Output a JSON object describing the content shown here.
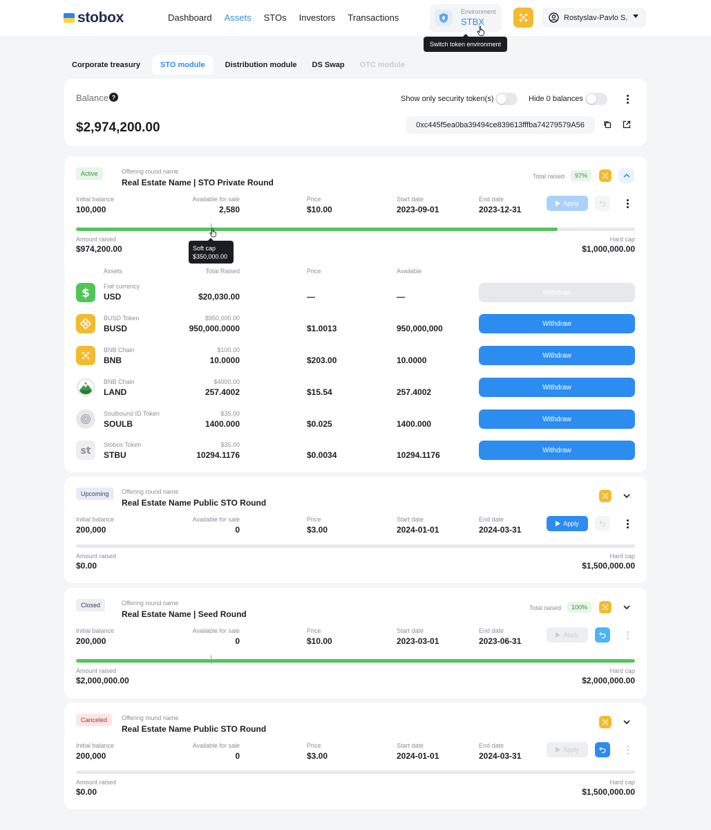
{
  "header": {
    "logo_text": "stobox",
    "nav": [
      "Dashboard",
      "Assets",
      "STOs",
      "Investors",
      "Transactions"
    ],
    "active_nav": "Assets",
    "env_label": "Environment",
    "env_value": "STBX",
    "env_tooltip": "Switch token environment",
    "user_name": "Rostyslav-Pavlo S."
  },
  "tabs": [
    "Corporate treasury",
    "STO module",
    "Distribution module",
    "DS Swap",
    "OTC module"
  ],
  "active_tab": "STO module",
  "balance": {
    "title": "Balance",
    "help": "?",
    "amount": "$2,974,200.00",
    "toggle_security_label": "Show only security token(s)",
    "toggle_zero_label": "Hide 0 balances",
    "address": "0xc445f5ea0ba39494ce839613fffba74279579A56"
  },
  "labels": {
    "offering_round_name": "Offering round name",
    "total_raised": "Total raised",
    "initial_balance": "Initial balance",
    "available_for_sale": "Available for sale",
    "price": "Price",
    "start_date": "Start date",
    "end_date": "End date",
    "apply": "Apply",
    "amount_raised": "Amount raised",
    "hard_cap": "Hard cap",
    "assets": "Assets",
    "total_raised_col": "Total Raised",
    "price_col": "Price",
    "available_col": "Available",
    "withdraw": "Withdraw",
    "soft_cap": "Soft cap",
    "soft_cap_value": "$350,000.00"
  },
  "rounds": [
    {
      "status": "Active",
      "name": "Real Estate Name | STO Private Round",
      "total_raised_pct": "97%",
      "initial_balance": "100,000",
      "available_for_sale": "2,580",
      "price": "$10.00",
      "start_date": "2023-09-01",
      "end_date": "2023-12-31",
      "amount_raised": "$974,200.00",
      "hard_cap": "$1,000,000.00",
      "progress": 0.862
    },
    {
      "status": "Upcoming",
      "name": "Real Estate Name Public STO Round",
      "initial_balance": "200,000",
      "available_for_sale": "0",
      "price": "$3.00",
      "start_date": "2024-01-01",
      "end_date": "2024-03-31",
      "amount_raised": "$0.00",
      "hard_cap": "$1,500,000.00",
      "progress": 0
    },
    {
      "status": "Closed",
      "name": "Real Estate Name | Seed Round",
      "total_raised_pct": "100%",
      "initial_balance": "200,000",
      "available_for_sale": "0",
      "price": "$10.00",
      "start_date": "2023-03-01",
      "end_date": "2023-06-31",
      "amount_raised": "$2,000,000.00",
      "hard_cap": "$2,000,000.00",
      "progress": 1
    },
    {
      "status": "Canceled",
      "name": "Real Estate Name Public STO Round",
      "initial_balance": "200,000",
      "available_for_sale": "0",
      "price": "$3.00",
      "start_date": "2024-01-01",
      "end_date": "2024-03-31",
      "amount_raised": "$0.00",
      "hard_cap": "$1,500,000.00",
      "progress": 0
    }
  ],
  "assets": [
    {
      "type": "Fiat currency",
      "symbol": "USD",
      "sub": "",
      "total": "$20,030.00",
      "price": "—",
      "available": "—",
      "icon": "dollar-icon",
      "withdraw_enabled": false
    },
    {
      "type": "BUSD Token",
      "symbol": "BUSD",
      "sub": "$950,000.00",
      "total": "950,000.0000",
      "price": "$1.0013",
      "available": "950,000,000",
      "icon": "busd-icon",
      "withdraw_enabled": true
    },
    {
      "type": "BNB Chain",
      "symbol": "BNB",
      "sub": "$100.00",
      "total": "10.0000",
      "price": "$203.00",
      "available": "10.0000",
      "icon": "bnb-icon",
      "withdraw_enabled": true
    },
    {
      "type": "BNB Chain",
      "symbol": "LAND",
      "sub": "$4000.00",
      "total": "257.4002",
      "price": "$15.54",
      "available": "257.4002",
      "icon": "land-icon",
      "withdraw_enabled": true
    },
    {
      "type": "Soulbound ID Token",
      "symbol": "SOULB",
      "sub": "$35.00",
      "total": "1400.000",
      "price": "$0.025",
      "available": "1400.000",
      "icon": "fingerprint-icon",
      "withdraw_enabled": true
    },
    {
      "type": "Stobox Token",
      "symbol": "STBU",
      "sub": "$35.00",
      "total": "10294.1176",
      "price": "$0.0034",
      "available": "10294.1176",
      "icon": "stbu-icon",
      "withdraw_enabled": true
    }
  ],
  "colors": {
    "accent": "#2d8cf0",
    "progress": "#52c55a",
    "bnb": "#f3ba2f"
  }
}
